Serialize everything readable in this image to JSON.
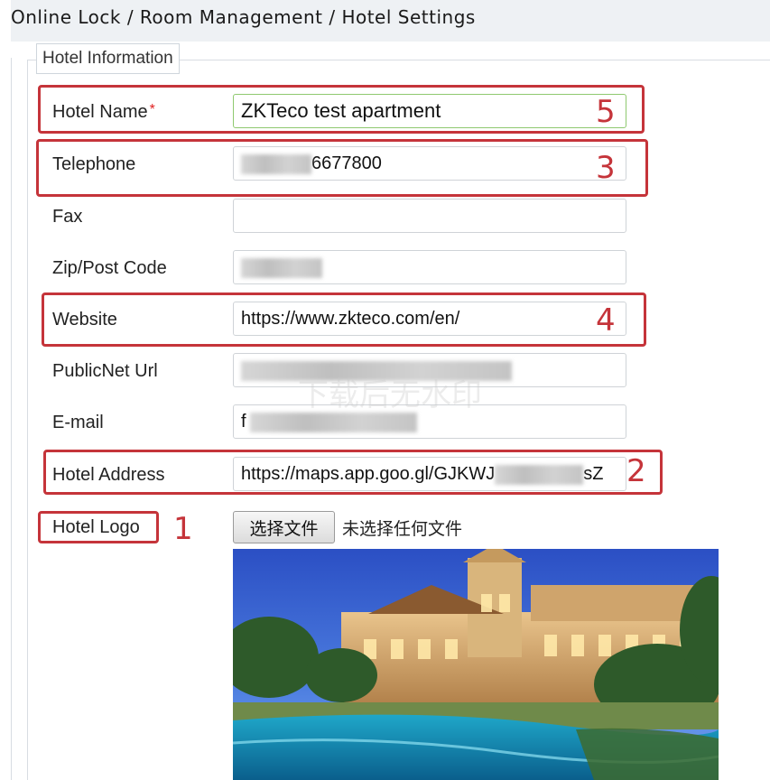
{
  "breadcrumb": "Online Lock / Room Management / Hotel Settings",
  "section": {
    "legend": "Hotel Information"
  },
  "fields": {
    "hotel_name": {
      "label": "Hotel Name",
      "required_mark": "*",
      "value": "ZKTeco test apartment"
    },
    "telephone": {
      "label": "Telephone",
      "value": "6677800"
    },
    "fax": {
      "label": "Fax",
      "value": ""
    },
    "zip": {
      "label": "Zip/Post Code",
      "value": ""
    },
    "website": {
      "label": "Website",
      "value": "https://www.zkteco.com/en/"
    },
    "publicnet": {
      "label": "PublicNet Url",
      "value": ""
    },
    "email": {
      "label": "E-mail",
      "value": "f"
    },
    "address": {
      "label": "Hotel Address",
      "value_start": "https://maps.app.goo.gl/GJKWJ",
      "value_end": "sZ"
    },
    "logo": {
      "label": "Hotel Logo",
      "button": "选择文件",
      "status": "未选择任何文件"
    }
  },
  "annotations": {
    "n1": "1",
    "n2": "2",
    "n3": "3",
    "n4": "4",
    "n5": "5"
  },
  "watermark": "下载后无水印",
  "colors": {
    "highlight": "#c5343a",
    "required": "#e02020",
    "name_border": "#8fc96f",
    "header_bg": "#eef1f4"
  }
}
